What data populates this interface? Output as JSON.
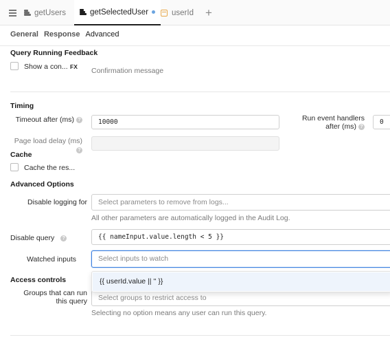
{
  "tabs": [
    {
      "label": "getUsers",
      "icon": "database-icon",
      "active": false
    },
    {
      "label": "getSelectedUser",
      "icon": "database-icon",
      "active": true,
      "unsaved": true
    },
    {
      "label": "userId",
      "icon": "calendar-icon",
      "active": false
    }
  ],
  "add_tab_symbol": "+",
  "subtabs": [
    "General",
    "Response",
    "Advanced"
  ],
  "feedback": {
    "title": "Query Running Feedback",
    "show_label": "Show a con...",
    "fx_label": "FX",
    "placeholder": "Confirmation message"
  },
  "timing": {
    "title": "Timing",
    "timeout_label": "Timeout after (ms)",
    "timeout_value": "10000",
    "page_load_label": "Page load delay (ms)",
    "page_load_value": "",
    "run_event_label": "Run event handlers after (ms)",
    "run_event_value": "0"
  },
  "cache": {
    "title": "Cache",
    "checkbox_label": "Cache the res..."
  },
  "advanced": {
    "title": "Advanced Options",
    "disable_logging_label": "Disable logging for",
    "disable_logging_placeholder": "Select parameters to remove from logs...",
    "logging_help": "All other parameters are automatically logged in the Audit Log.",
    "disable_query_label": "Disable query",
    "disable_query_value": "{{ nameInput.value.length < 5 }}",
    "watched_inputs_label": "Watched inputs",
    "watched_inputs_placeholder": "Select inputs to watch"
  },
  "dropdown": {
    "option": "{{ userId.value || '' }}"
  },
  "access": {
    "title": "Access controls",
    "groups_label": "Groups that can run this query",
    "groups_placeholder": "Select groups to restrict access to",
    "groups_help": "Selecting no option means any user can run this query."
  },
  "help_glyph": "?",
  "colors": {
    "accent": "#3f82e0",
    "unsaved_dot": "#6ba4e0",
    "calendar": "#e8a84a"
  }
}
